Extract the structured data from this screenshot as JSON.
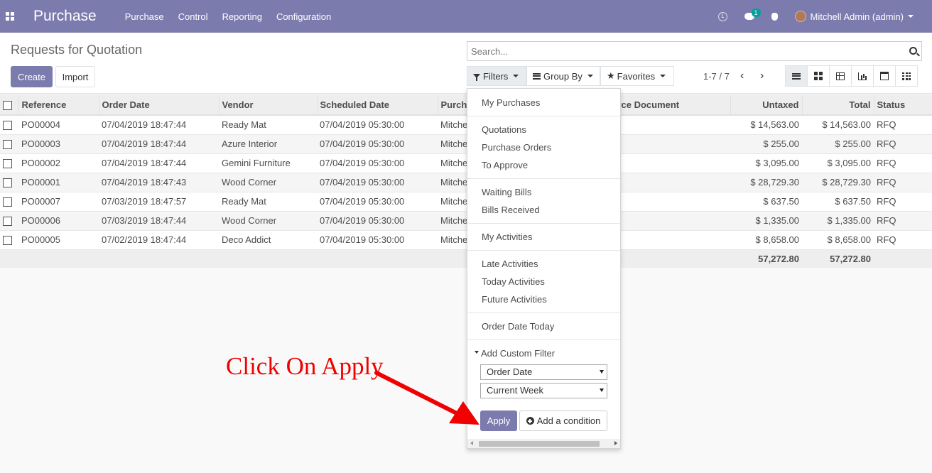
{
  "navbar": {
    "app_name": "Purchase",
    "menu": [
      "Purchase",
      "Control",
      "Reporting",
      "Configuration"
    ],
    "chat_badge": "1",
    "user": "Mitchell Admin (admin)",
    "color": "#7c7bad"
  },
  "control_panel": {
    "title": "Requests for Quotation",
    "create_label": "Create",
    "import_label": "Import",
    "search_placeholder": "Search...",
    "filters_label": "Filters",
    "group_by_label": "Group By",
    "favorites_label": "Favorites",
    "pager": "1-7 / 7"
  },
  "table": {
    "headers": {
      "reference": "Reference",
      "order_date": "Order Date",
      "vendor": "Vendor",
      "scheduled_date": "Scheduled Date",
      "purchase_rep": "Purch",
      "source_document": "urce Document",
      "untaxed": "Untaxed",
      "total": "Total",
      "status": "Status"
    },
    "rows": [
      {
        "reference": "PO00004",
        "order_date": "07/04/2019 18:47:44",
        "vendor": "Ready Mat",
        "scheduled_date": "07/04/2019 05:30:00",
        "purchase_rep": "Mitche",
        "untaxed": "$ 14,563.00",
        "total": "$ 14,563.00",
        "status": "RFQ"
      },
      {
        "reference": "PO00003",
        "order_date": "07/04/2019 18:47:44",
        "vendor": "Azure Interior",
        "scheduled_date": "07/04/2019 05:30:00",
        "purchase_rep": "Mitche",
        "untaxed": "$ 255.00",
        "total": "$ 255.00",
        "status": "RFQ"
      },
      {
        "reference": "PO00002",
        "order_date": "07/04/2019 18:47:44",
        "vendor": "Gemini Furniture",
        "scheduled_date": "07/04/2019 05:30:00",
        "purchase_rep": "Mitche",
        "untaxed": "$ 3,095.00",
        "total": "$ 3,095.00",
        "status": "RFQ"
      },
      {
        "reference": "PO00001",
        "order_date": "07/04/2019 18:47:43",
        "vendor": "Wood Corner",
        "scheduled_date": "07/04/2019 05:30:00",
        "purchase_rep": "Mitche",
        "untaxed": "$ 28,729.30",
        "total": "$ 28,729.30",
        "status": "RFQ"
      },
      {
        "reference": "PO00007",
        "order_date": "07/03/2019 18:47:57",
        "vendor": "Ready Mat",
        "scheduled_date": "07/04/2019 05:30:00",
        "purchase_rep": "Mitche",
        "untaxed": "$ 637.50",
        "total": "$ 637.50",
        "status": "RFQ"
      },
      {
        "reference": "PO00006",
        "order_date": "07/03/2019 18:47:44",
        "vendor": "Wood Corner",
        "scheduled_date": "07/04/2019 05:30:00",
        "purchase_rep": "Mitche",
        "untaxed": "$ 1,335.00",
        "total": "$ 1,335.00",
        "status": "RFQ"
      },
      {
        "reference": "PO00005",
        "order_date": "07/02/2019 18:47:44",
        "vendor": "Deco Addict",
        "scheduled_date": "07/04/2019 05:30:00",
        "purchase_rep": "Mitche",
        "untaxed": "$ 8,658.00",
        "total": "$ 8,658.00",
        "status": "RFQ"
      }
    ],
    "totals": {
      "untaxed": "57,272.80",
      "total": "57,272.80"
    }
  },
  "filters_dropdown": {
    "my_purchases": "My Purchases",
    "quotations": "Quotations",
    "purchase_orders": "Purchase Orders",
    "to_approve": "To Approve",
    "waiting_bills": "Waiting Bills",
    "bills_received": "Bills Received",
    "my_activities": "My Activities",
    "late_activities": "Late Activities",
    "today_activities": "Today Activities",
    "future_activities": "Future Activities",
    "order_date_today": "Order Date Today",
    "add_custom_filter": "Add Custom Filter",
    "field_select": "Order Date",
    "operator_select": "Current Week",
    "apply_label": "Apply",
    "add_condition_label": "Add a condition"
  },
  "annotation": {
    "text": "Click On Apply",
    "color": "#f00000"
  }
}
